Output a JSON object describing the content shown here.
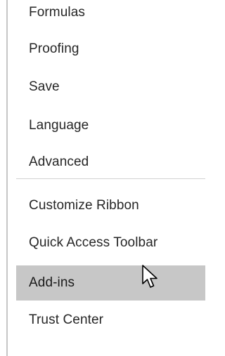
{
  "options_nav": {
    "items": [
      {
        "label": "Formulas"
      },
      {
        "label": "Proofing"
      },
      {
        "label": "Save"
      },
      {
        "label": "Language"
      },
      {
        "label": "Advanced"
      },
      {
        "label": "Customize Ribbon"
      },
      {
        "label": "Quick Access Toolbar"
      },
      {
        "label": "Add-ins",
        "state": "hovered"
      },
      {
        "label": "Trust Center"
      }
    ]
  },
  "cursor": {
    "icon": "mouse-pointer-arrow-icon"
  },
  "colors": {
    "hover_background": "#c7c7c7",
    "text": "#262626",
    "separator": "#d2d2d2"
  }
}
